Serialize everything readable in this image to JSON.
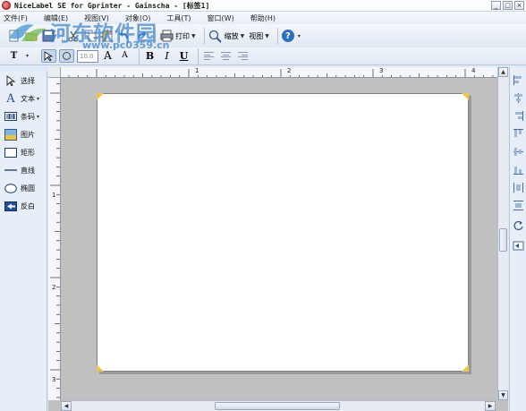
{
  "window": {
    "title": "NiceLabel SE for Gprinter - Gainscha - [标签1]",
    "controls": [
      "_",
      "□",
      "×"
    ]
  },
  "watermark": {
    "title": "河东软件园",
    "url": "www.pc0359.cn"
  },
  "menu": {
    "items": [
      "文件(F)",
      "编辑(E)",
      "视图(V)",
      "对象(O)",
      "工具(T)",
      "窗口(W)",
      "帮助(H)"
    ]
  },
  "toolbar": {
    "print_label": "打印",
    "zoom_label": "缩放",
    "view_label": "视图",
    "help_label": "?"
  },
  "format_toolbar": {
    "text_label": "T",
    "font_size": "10.0",
    "grow_label": "A",
    "shrink_label": "A",
    "bold_label": "B",
    "italic_label": "I",
    "underline_label": "U"
  },
  "toolbox": {
    "items": [
      {
        "label": "选择",
        "icon": "arrow-cursor-icon"
      },
      {
        "label": "文本",
        "icon": "text-icon",
        "dropdown": true
      },
      {
        "label": "条码",
        "icon": "barcode-icon",
        "dropdown": true
      },
      {
        "label": "图片",
        "icon": "picture-icon"
      },
      {
        "label": "矩形",
        "icon": "rectangle-icon"
      },
      {
        "label": "直线",
        "icon": "line-icon"
      },
      {
        "label": "椭圆",
        "icon": "ellipse-icon"
      },
      {
        "label": "反白",
        "icon": "inverse-icon"
      }
    ]
  },
  "rulers": {
    "horizontal": [
      "1",
      "2",
      "3",
      "4"
    ],
    "vertical": [
      "1",
      "2",
      "3"
    ]
  },
  "colors": {
    "accent": "#3c82c8",
    "workspace": "#c0c0c0",
    "canvas": "#ffffff",
    "corner_mark": "#e8c84a"
  }
}
